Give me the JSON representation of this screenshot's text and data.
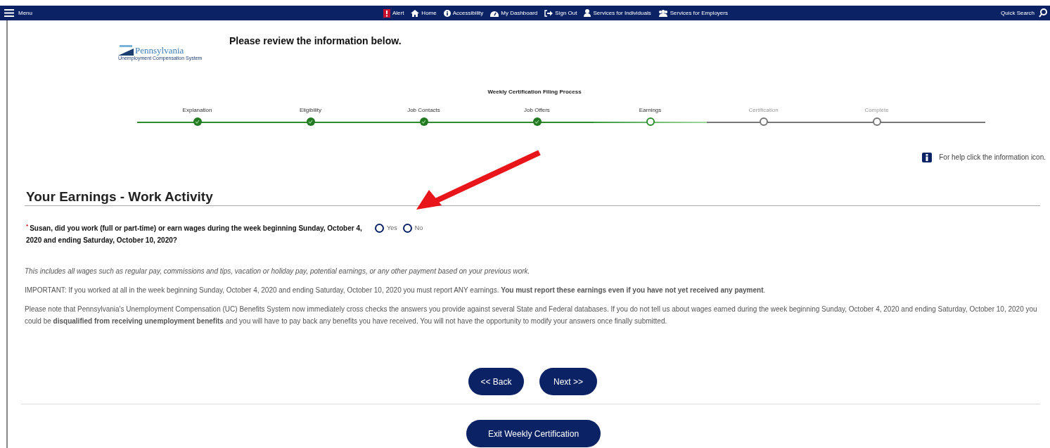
{
  "nav": {
    "menu_label": "Menu",
    "items": [
      {
        "kind": "alert",
        "label": "Alert"
      },
      {
        "kind": "home",
        "label": "Home"
      },
      {
        "kind": "accessibility",
        "label": "Accessibility"
      },
      {
        "kind": "dashboard",
        "label": "My Dashboard"
      },
      {
        "kind": "signout",
        "label": "Sign Out"
      },
      {
        "kind": "person",
        "label": "Services for Individuals"
      },
      {
        "kind": "group",
        "label": "Services for Employers"
      }
    ],
    "search_label": "Quick Search"
  },
  "logo": {
    "name": "Pennsylvania",
    "subtitle": "Unemployment Compensation System"
  },
  "page_title": "Please review the information below.",
  "progress": {
    "title": "Weekly Certification Filing Process",
    "steps": [
      {
        "label": "Explanation",
        "completed": true,
        "current": false
      },
      {
        "label": "Eligibility",
        "completed": true,
        "current": false
      },
      {
        "label": "Job Contacts",
        "completed": true,
        "current": false
      },
      {
        "label": "Job Offers",
        "completed": true,
        "current": false
      },
      {
        "label": "Earnings",
        "completed": false,
        "current": true
      },
      {
        "label": "Certification",
        "completed": false,
        "current": false
      },
      {
        "label": "Complete",
        "completed": false,
        "current": false
      }
    ]
  },
  "help_text": "For help click the information icon.",
  "section_title": "Your Earnings - Work Activity",
  "question": {
    "required_mark": "*",
    "text": "Susan, did you work (full or part-time) or earn wages during the week beginning Sunday, October 4, 2020 and ending Saturday, October 10, 2020?",
    "options": [
      {
        "label": "Yes",
        "selected": false
      },
      {
        "label": "No",
        "selected": false
      }
    ]
  },
  "notes": [
    {
      "kind": "italic",
      "text": "This includes all wages such as regular pay, commissions and tips, vacation or holiday pay, potential earnings, or any other payment based on your previous work."
    },
    {
      "kind": "plain",
      "text": "IMPORTANT: If you worked at all in the week beginning Sunday, October 4, 2020 and ending Saturday, October 10, 2020 you must report ANY earnings. **You must report these earnings even if you have not yet received any payment**."
    },
    {
      "kind": "plain",
      "text": "Please note that Pennsylvania's Unemployment Compensation (UC) Benefits System now immediately cross checks the answers you provide against several State and Federal databases. If you do not tell us about wages earned during the week beginning Sunday, October 4, 2020 and ending Saturday, October 10, 2020 you could be **disqualified from receiving unemployment benefits** and you will have to pay back any benefits you have received. You will not have the opportunity to modify your answers once finally submitted."
    }
  ],
  "buttons": {
    "back": "<< Back",
    "next": "Next >>",
    "exit": "Exit Weekly Certification"
  }
}
